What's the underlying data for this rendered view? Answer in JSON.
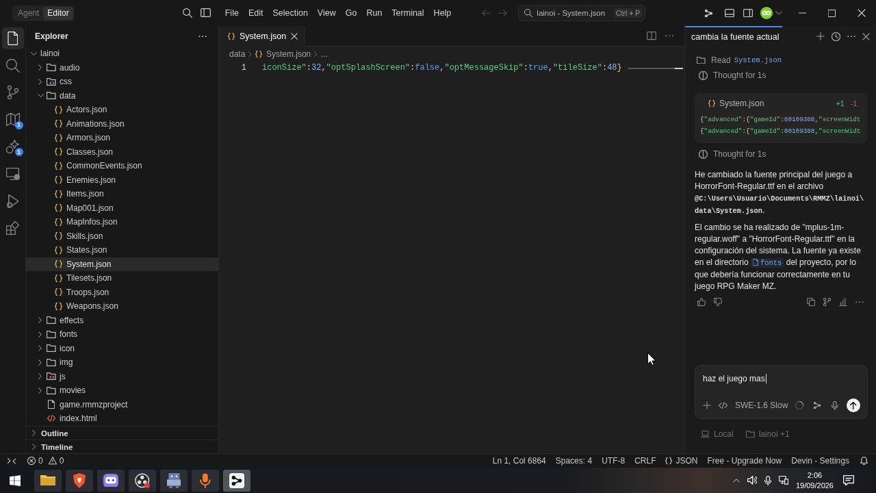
{
  "title_bar": {
    "modes": [
      {
        "label": "Agent",
        "selected": false
      },
      {
        "label": "Editor",
        "selected": true
      }
    ],
    "menu": [
      "File",
      "Edit",
      "Selection",
      "View",
      "Go",
      "Run",
      "Terminal",
      "Help"
    ],
    "navigation": [
      {
        "kind": "back",
        "disabled": true
      },
      {
        "kind": "forward",
        "disabled": true
      }
    ],
    "command_center": {
      "value": "lainoi - System.json",
      "shortcut": "Ctrl + P"
    }
  },
  "activity_bar": [
    {
      "kind": "explorer",
      "selected": true
    },
    {
      "kind": "search",
      "selected": false
    },
    {
      "kind": "source-control",
      "selected": false
    },
    {
      "kind": "map",
      "selected": false,
      "badge": "1"
    },
    {
      "kind": "sparkle",
      "selected": false,
      "badge": "1"
    },
    {
      "kind": "remote",
      "selected": false
    },
    {
      "kind": "run",
      "selected": false
    },
    {
      "kind": "extensions",
      "selected": false
    }
  ],
  "sidebar": {
    "title": "Explorer",
    "tree": [
      {
        "label": "lainoi",
        "kind": "root",
        "expanded": true,
        "selected": false,
        "children": [
          {
            "label": "audio",
            "kind": "folder",
            "expanded": false,
            "selected": false
          },
          {
            "label": "css",
            "kind": "css-folder",
            "expanded": false,
            "selected": false
          },
          {
            "label": "data",
            "kind": "folder",
            "expanded": true,
            "selected": false,
            "children": [
              {
                "label": "Actors.json",
                "kind": "json",
                "selected": false
              },
              {
                "label": "Animations.json",
                "kind": "json",
                "selected": false
              },
              {
                "label": "Armors.json",
                "kind": "json",
                "selected": false
              },
              {
                "label": "Classes.json",
                "kind": "json",
                "selected": false
              },
              {
                "label": "CommonEvents.json",
                "kind": "json",
                "selected": false
              },
              {
                "label": "Enemies.json",
                "kind": "json",
                "selected": false
              },
              {
                "label": "Items.json",
                "kind": "json",
                "selected": false
              },
              {
                "label": "Map001.json",
                "kind": "json",
                "selected": false
              },
              {
                "label": "MapInfos.json",
                "kind": "json",
                "selected": false
              },
              {
                "label": "Skills.json",
                "kind": "json",
                "selected": false
              },
              {
                "label": "States.json",
                "kind": "json",
                "selected": false
              },
              {
                "label": "System.json",
                "kind": "json",
                "selected": true
              },
              {
                "label": "Tilesets.json",
                "kind": "json",
                "selected": false
              },
              {
                "label": "Troops.json",
                "kind": "json",
                "selected": false
              },
              {
                "label": "Weapons.json",
                "kind": "json",
                "selected": false
              }
            ]
          },
          {
            "label": "effects",
            "kind": "folder",
            "expanded": false,
            "selected": false
          },
          {
            "label": "fonts",
            "kind": "folder",
            "expanded": false,
            "selected": false
          },
          {
            "label": "icon",
            "kind": "folder",
            "expanded": false,
            "selected": false
          },
          {
            "label": "img",
            "kind": "folder",
            "expanded": false,
            "selected": false
          },
          {
            "label": "js",
            "kind": "js-folder",
            "expanded": false,
            "selected": false
          },
          {
            "label": "movies",
            "kind": "folder",
            "expanded": false,
            "selected": false
          },
          {
            "label": "game.rmmzproject",
            "kind": "file",
            "selected": false
          },
          {
            "label": "index.html",
            "kind": "html",
            "selected": false
          }
        ]
      }
    ],
    "sections": [
      {
        "label": "Outline",
        "expanded": false
      },
      {
        "label": "Timeline",
        "expanded": false
      }
    ]
  },
  "editor": {
    "tabs": [
      {
        "label": "System.json",
        "selected": true
      }
    ],
    "breadcrumbs": [
      {
        "label": "data",
        "kind": "plain"
      },
      {
        "label": "System.json",
        "kind": "json"
      },
      {
        "label": "...",
        "kind": "plain"
      }
    ],
    "lines": [
      {
        "number": "1",
        "tokens": [
          {
            "kind": "key",
            "text": "iconSize\""
          },
          {
            "kind": "punct",
            "text": ":"
          },
          {
            "kind": "number",
            "text": "32"
          },
          {
            "kind": "punct",
            "text": ","
          },
          {
            "kind": "key",
            "text": "\"optSplashScreen\""
          },
          {
            "kind": "punct",
            "text": ":"
          },
          {
            "kind": "keyword",
            "text": "false"
          },
          {
            "kind": "punct",
            "text": ","
          },
          {
            "kind": "key",
            "text": "\"optMessageSkip\""
          },
          {
            "kind": "punct",
            "text": ":"
          },
          {
            "kind": "keyword",
            "text": "true"
          },
          {
            "kind": "punct",
            "text": ","
          },
          {
            "kind": "key",
            "text": "\"tileSize\""
          },
          {
            "kind": "punct",
            "text": ":"
          },
          {
            "kind": "number",
            "text": "48"
          },
          {
            "kind": "bracket",
            "text": "}"
          }
        ]
      }
    ]
  },
  "chat": {
    "tab": {
      "label": "cambia la fuente actual",
      "selected": true
    },
    "items": [
      {
        "kind": "read",
        "label": "Read",
        "file": "System.json"
      },
      {
        "kind": "thought",
        "label": "Thought for 1s"
      },
      {
        "kind": "diff",
        "file": "System.json",
        "added": "+1",
        "removed": "-1",
        "lines": [
          {
            "kind": "removed",
            "tokens": [
              {
                "kind": "bracket",
                "text": "{"
              },
              {
                "kind": "key",
                "text": "\"advanced\""
              },
              {
                "kind": "punct",
                "text": ":"
              },
              {
                "kind": "bracket",
                "text": "{"
              },
              {
                "kind": "key",
                "text": "\"gameId\""
              },
              {
                "kind": "punct",
                "text": ":"
              },
              {
                "kind": "number",
                "text": "80109388"
              },
              {
                "kind": "punct",
                "text": ","
              },
              {
                "kind": "key",
                "text": "\"screenWidt"
              }
            ]
          },
          {
            "kind": "added",
            "tokens": [
              {
                "kind": "bracket",
                "text": "{"
              },
              {
                "kind": "key",
                "text": "\"advanced\""
              },
              {
                "kind": "punct",
                "text": ":"
              },
              {
                "kind": "bracket",
                "text": "{"
              },
              {
                "kind": "key",
                "text": "\"gameId\""
              },
              {
                "kind": "punct",
                "text": ":"
              },
              {
                "kind": "number",
                "text": "80109388"
              },
              {
                "kind": "punct",
                "text": ","
              },
              {
                "kind": "key",
                "text": "\"screenWidt"
              }
            ]
          }
        ]
      },
      {
        "kind": "thought",
        "label": "Thought for 1s"
      },
      {
        "kind": "message",
        "parts": [
          {
            "kind": "text",
            "text": "He cambiado la fuente principal del juego a HorrorFont-Regular.ttf en el archivo "
          },
          {
            "kind": "code",
            "text": "@C:\\Users\\Usuario\\Documents\\RMMZ\\lainoi\\data\\System.json"
          },
          {
            "kind": "text",
            "text": "."
          }
        ]
      },
      {
        "kind": "message",
        "parts": [
          {
            "kind": "text",
            "text": "El cambio se ha realizado de \"mplus-1m-regular.woff\" a \"HorrorFont-Regular.ttf\" en la configuración del sistema. La fuente ya existe en el directorio "
          },
          {
            "kind": "link",
            "text": "fonts"
          },
          {
            "kind": "text",
            "text": " del proyecto, por lo que debería funcionar correctamente en tu juego RPG Maker MZ."
          }
        ]
      },
      {
        "kind": "feedback"
      }
    ],
    "composer": {
      "value": "haz el juego mas",
      "model": "SWE-1.6 Slow"
    },
    "context": [
      {
        "kind": "local",
        "label": "Local"
      },
      {
        "kind": "folder",
        "label": "lainoi +1"
      }
    ]
  },
  "status_bar": {
    "errors": "0",
    "warnings": "0",
    "items": [
      {
        "kind": "text",
        "label": "Ln 1, Col 6864"
      },
      {
        "kind": "text",
        "label": "Spaces: 4"
      },
      {
        "kind": "text",
        "label": "UTF-8"
      },
      {
        "kind": "text",
        "label": "CRLF"
      },
      {
        "kind": "language",
        "label": "JSON"
      },
      {
        "kind": "text",
        "label": "Free - Upgrade Now"
      },
      {
        "kind": "text",
        "label": "Devin - Settings"
      }
    ]
  },
  "taskbar": {
    "apps": [
      {
        "kind": "files",
        "selected": false
      },
      {
        "kind": "browser",
        "selected": false
      },
      {
        "kind": "chat",
        "selected": false
      },
      {
        "kind": "recorder",
        "selected": false
      },
      {
        "kind": "game",
        "selected": false
      },
      {
        "kind": "microphone",
        "selected": false
      },
      {
        "kind": "editor",
        "selected": true
      }
    ],
    "time": "2:06",
    "date": "19/09/2026"
  }
}
